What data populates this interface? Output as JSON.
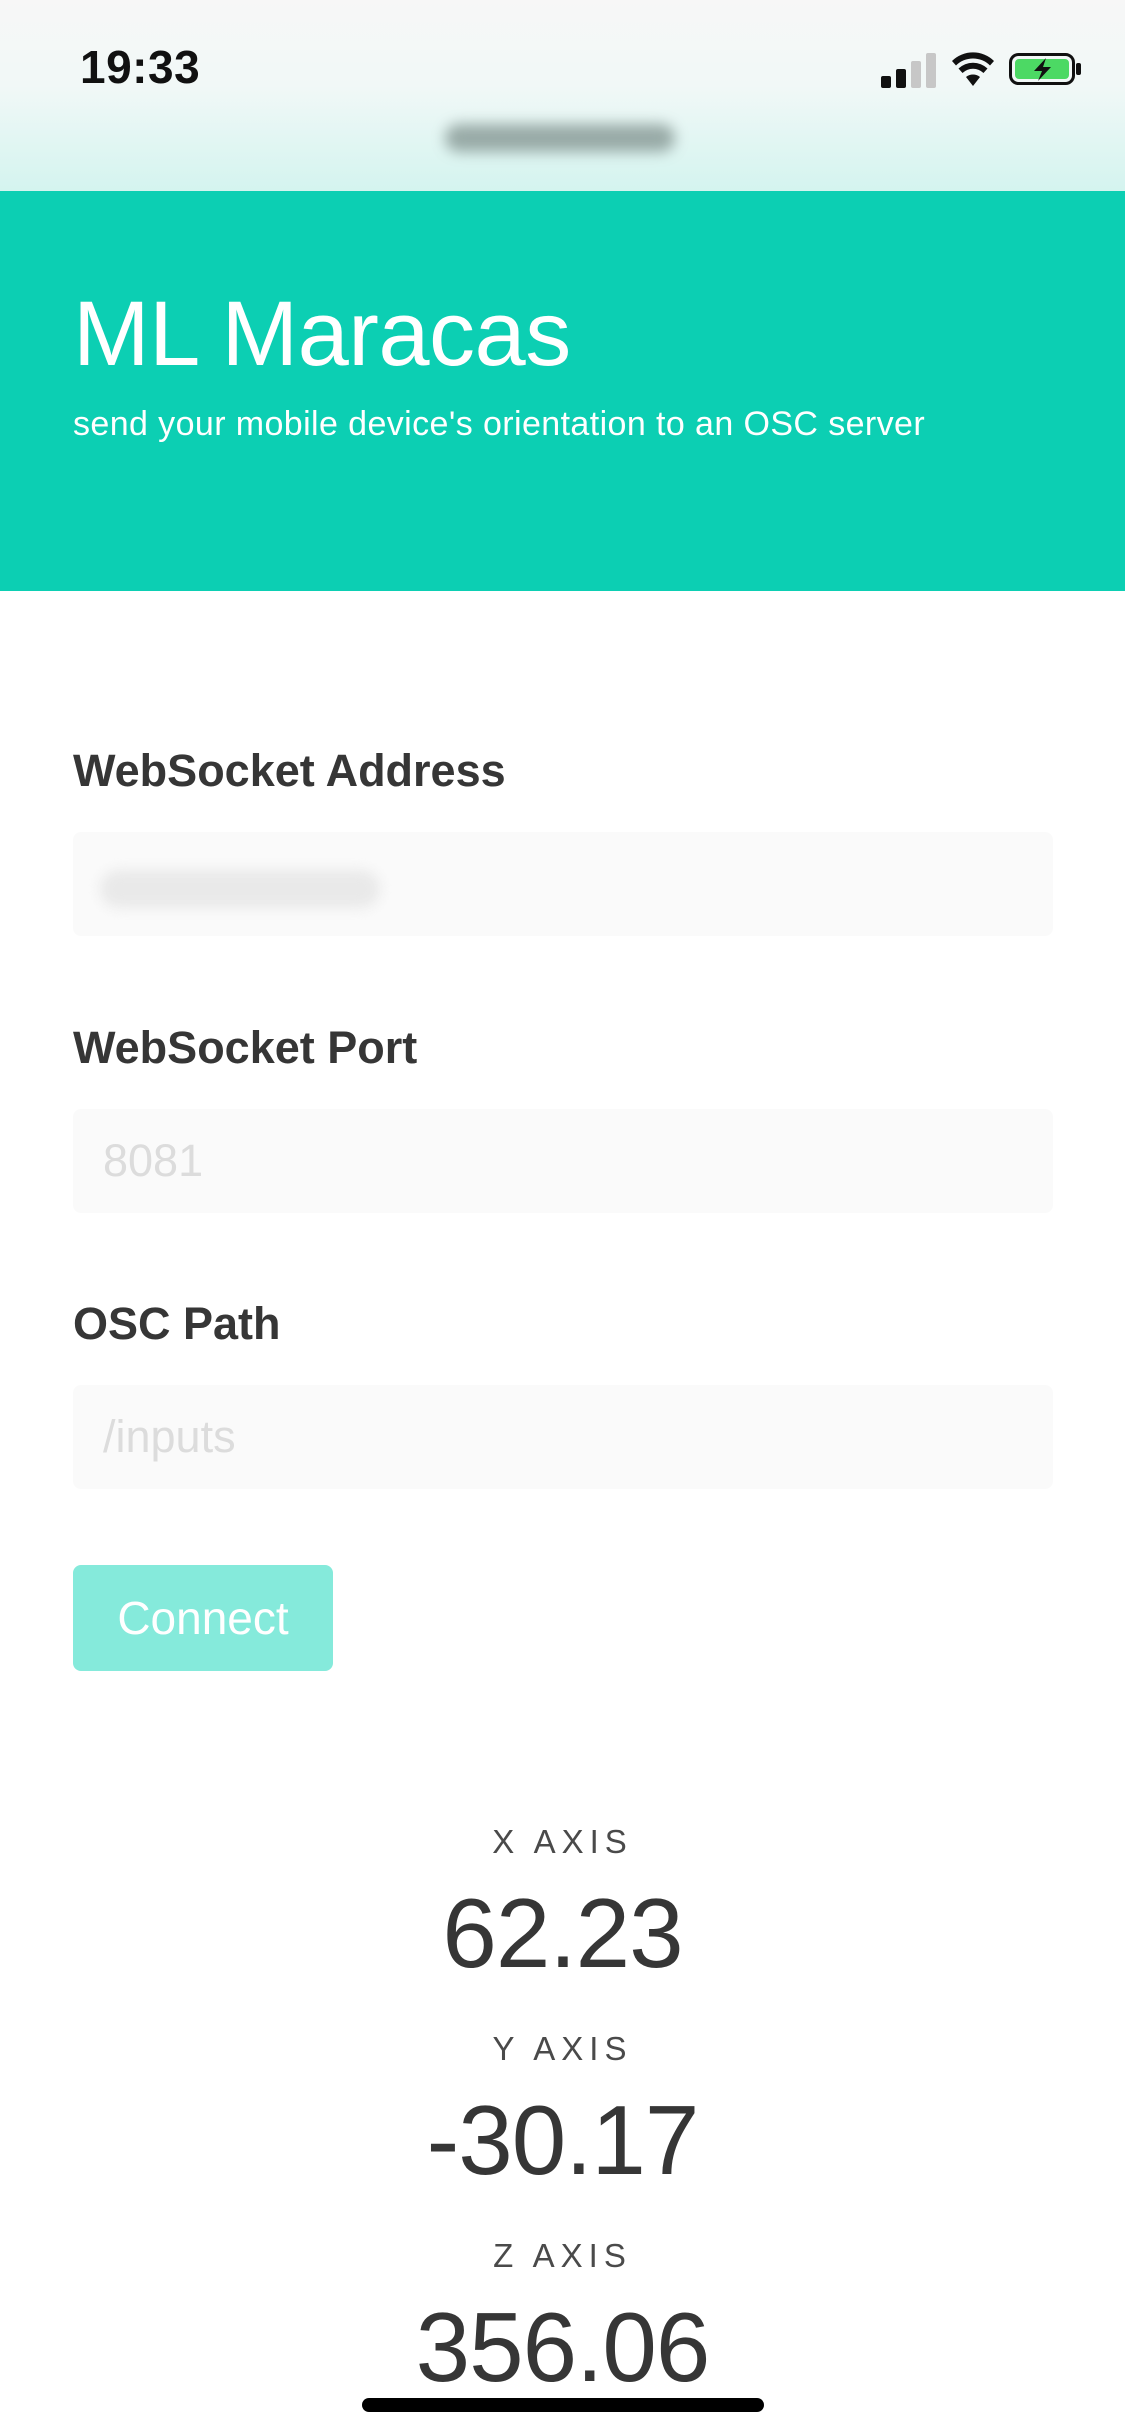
{
  "status_bar": {
    "time": "19:33",
    "icons": [
      "signal-icon",
      "wifi-icon",
      "battery-charging-icon"
    ],
    "battery_color": "#4cd964"
  },
  "hero": {
    "title": "ML Maracas",
    "subtitle": "send your mobile device's orientation to an OSC server",
    "background_color": "#0ccfb3"
  },
  "form": {
    "address": {
      "label": "WebSocket Address",
      "value": ""
    },
    "port": {
      "label": "WebSocket Port",
      "placeholder": "8081",
      "value": ""
    },
    "osc_path": {
      "label": "OSC Path",
      "placeholder": "/inputs",
      "value": ""
    },
    "connect_label": "Connect",
    "connect_color": "#85eadb"
  },
  "axes": {
    "x": {
      "label": "X AXIS",
      "value": "62.23"
    },
    "y": {
      "label": "Y AXIS",
      "value": "-30.17"
    },
    "z": {
      "label": "Z AXIS",
      "value": "356.06"
    }
  }
}
